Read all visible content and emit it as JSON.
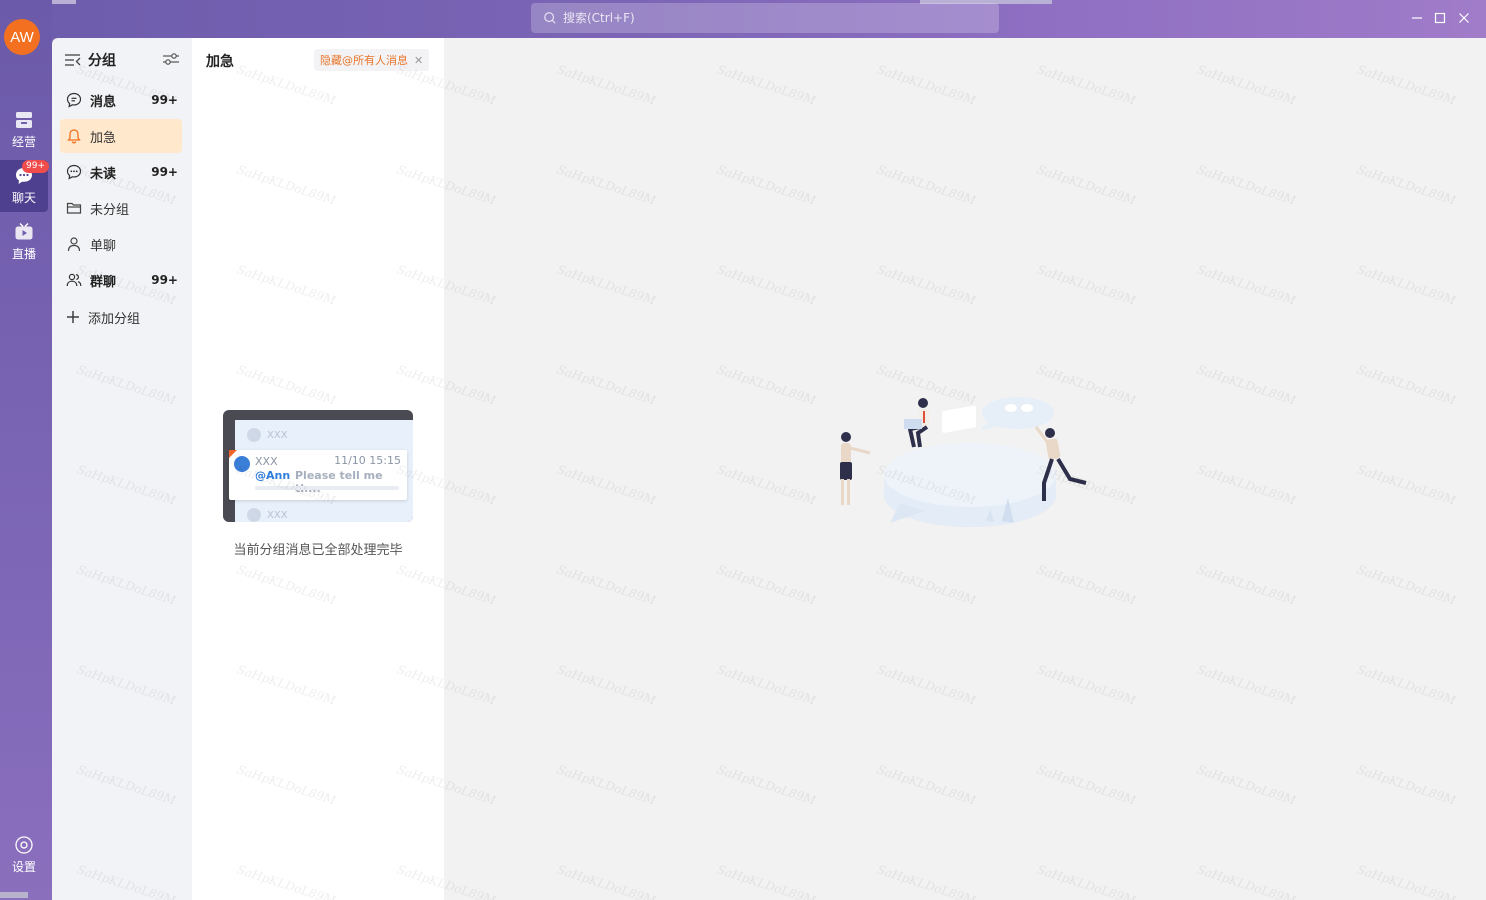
{
  "app": {
    "search_placeholder": "搜索(Ctrl+F)",
    "avatar_initials": "AW",
    "watermark": "SaHpKLDoL89M"
  },
  "rail": {
    "items": [
      {
        "label": "经营",
        "icon": "store-icon"
      },
      {
        "label": "聊天",
        "icon": "chat-bubble-icon",
        "badge": "99+"
      },
      {
        "label": "直播",
        "icon": "tv-icon"
      }
    ],
    "settings_label": "设置"
  },
  "groups": {
    "title": "分组",
    "items": [
      {
        "label": "消息",
        "count": "99+",
        "icon": "message-icon"
      },
      {
        "label": "加急",
        "count": "",
        "icon": "bell-icon"
      },
      {
        "label": "未读",
        "count": "99+",
        "icon": "unread-icon"
      },
      {
        "label": "未分组",
        "count": "",
        "icon": "folder-icon"
      },
      {
        "label": "单聊",
        "count": "",
        "icon": "person-icon"
      },
      {
        "label": "群聊",
        "count": "99+",
        "icon": "group-icon"
      },
      {
        "label": "添加分组",
        "count": "",
        "icon": "plus-icon"
      }
    ]
  },
  "list": {
    "title": "加急",
    "hide_tag": "隐藏@所有人消息",
    "empty_text": "当前分组消息已全部处理完毕",
    "card": {
      "placeholder_name": "XXX",
      "name": "XXX",
      "time": "11/10 15:15",
      "mention": "@Ann",
      "message": "Please tell me th..."
    }
  },
  "colors": {
    "accent": "#f2701f",
    "active_group_bg": "#ffe8cc",
    "hide_tag_text": "#e8752a",
    "badge": "#f04c4c"
  }
}
